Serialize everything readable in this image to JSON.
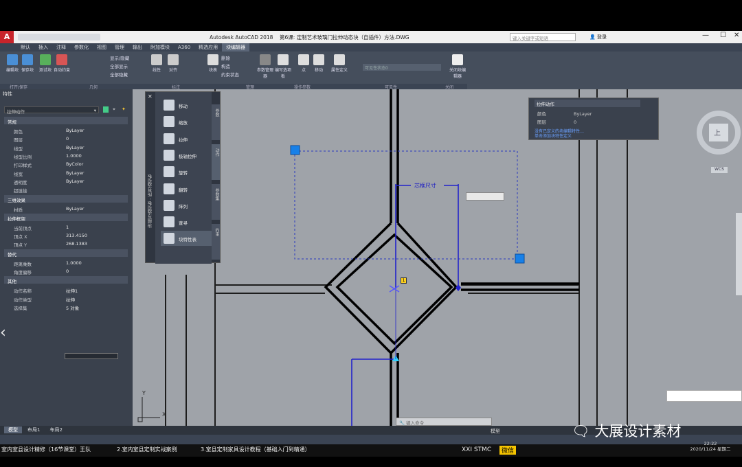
{
  "window": {
    "title": "Autodesk AutoCAD 2018",
    "doc": "第6课: 定制艺术玻璃门拉伸动态块（自插件）方法.DWG",
    "search_placeholder": "键入关键字或短语",
    "login": "登录"
  },
  "menu_tabs": [
    "默认",
    "插入",
    "注释",
    "参数化",
    "视图",
    "管理",
    "输出",
    "附加模块",
    "A360",
    "精选应用",
    "块编辑器"
  ],
  "ribbon": {
    "buttons": [
      "编辑块",
      "保存块",
      "测试块",
      "自动约束",
      "线性",
      "对齐",
      "块表",
      "参数管理器",
      "编写选项板",
      "点",
      "移动",
      "属性定义",
      "关闭块编辑器"
    ],
    "small": [
      "显示/隐藏",
      "全部显示",
      "全部隐藏",
      "删除",
      "构造",
      "约束状态"
    ],
    "groups": [
      "打开/保存",
      "几何",
      "标注",
      "管理",
      "操作参数",
      "可见性",
      "关闭"
    ],
    "visibility_state": "可见性状态0"
  },
  "properties": {
    "title": "特性",
    "selector": "拉伸动作",
    "sections": {
      "general": "常规",
      "3d": "三维效果",
      "frame": "拉伸框架",
      "overrides": "替代",
      "misc": "其他"
    },
    "general": [
      {
        "k": "颜色",
        "v": "ByLayer"
      },
      {
        "k": "图层",
        "v": "0"
      },
      {
        "k": "线型",
        "v": "ByLayer"
      },
      {
        "k": "线型比例",
        "v": "1.0000"
      },
      {
        "k": "打印样式",
        "v": "ByColor"
      },
      {
        "k": "线宽",
        "v": "ByLayer"
      },
      {
        "k": "透明度",
        "v": "ByLayer"
      },
      {
        "k": "超链接",
        "v": ""
      }
    ],
    "material": {
      "k": "材质",
      "v": "ByLayer"
    },
    "frame": [
      {
        "k": "当前顶点",
        "v": "1"
      },
      {
        "k": "顶点 X",
        "v": "313.4150"
      },
      {
        "k": "顶点 Y",
        "v": "268.1383"
      }
    ],
    "overrides": [
      {
        "k": "距离乘数",
        "v": "1.0000"
      },
      {
        "k": "角度偏移",
        "v": "0"
      }
    ],
    "misc": [
      {
        "k": "动作名称",
        "v": "拉伸1"
      },
      {
        "k": "动作类型",
        "v": "拉伸"
      },
      {
        "k": "选择集",
        "v": "5 对象"
      }
    ]
  },
  "palette": {
    "title": "块编写选项板 - 所有选项板",
    "items": [
      "移动",
      "缩放",
      "拉伸",
      "极轴拉伸",
      "旋转",
      "翻转",
      "阵列",
      "查寻",
      "块特性表"
    ],
    "side_tabs": [
      "参数",
      "动作",
      "参数集",
      "约束"
    ]
  },
  "float_props": {
    "title": "拉伸动作",
    "rows": [
      {
        "k": "颜色",
        "v": "ByLayer"
      },
      {
        "k": "图层",
        "v": "0"
      }
    ],
    "link1": "没有已定义的块编辑特性…",
    "link2": "单击添加块特性定义"
  },
  "canvas": {
    "dim_label": "芯框尺寸",
    "grip_badge": "1",
    "ucs_y": "Y",
    "ucs_x": "X",
    "compass": "上",
    "wcs": "WCS"
  },
  "command": {
    "placeholder": "键入命令"
  },
  "layout_tabs": [
    "模型",
    "布局1",
    "布局2"
  ],
  "status": {
    "model": "模型"
  },
  "taskbar": {
    "items": [
      "室内室县设计精修（16节课堂）王队",
      "2.室内室县定制实战案例",
      "3.室县定制家具设计教程（基础入门到精通）"
    ],
    "brand": "XXI STMC",
    "tag": "微信",
    "watermark": "大展设计素材",
    "time": "22:22",
    "date": "2020/11/24 星期二"
  }
}
